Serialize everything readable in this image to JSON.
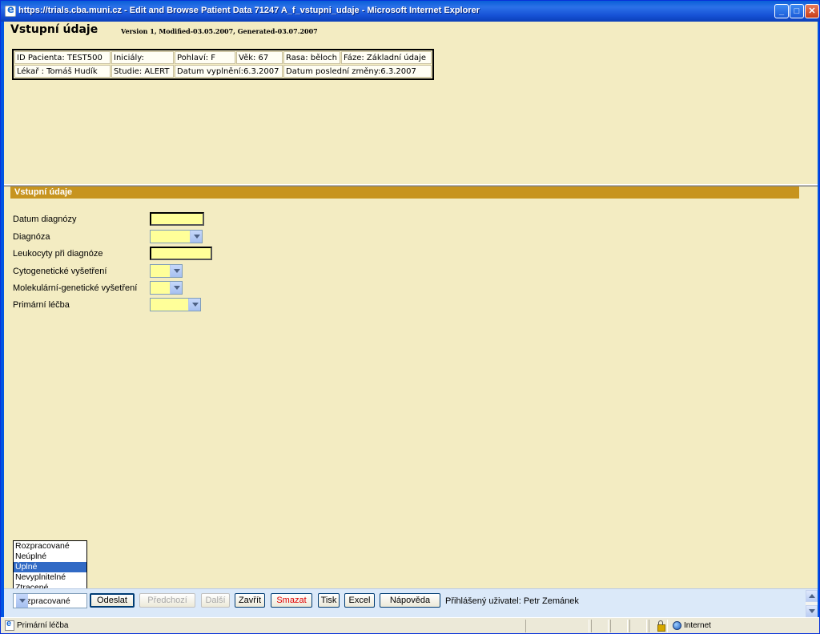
{
  "window": {
    "title": "https://trials.cba.muni.cz - Edit and Browse Patient Data 71247 A_f_vstupni_udaje - Microsoft Internet Explorer",
    "minimize": "_",
    "maximize": "□",
    "close": "✕"
  },
  "header": {
    "title": "Vstupní údaje",
    "version": "Version 1, Modified-03.05.2007, Generated-03.07.2007"
  },
  "patient": {
    "row1": [
      "ID Pacienta: TEST500",
      "Iniciály:",
      "Pohlaví: F",
      "Věk: 67",
      "Rasa: běloch",
      "Fáze: Základní údaje"
    ],
    "row2": [
      "Lékař : Tomáš Hudík",
      "Studie: ALERT",
      "Datum vyplnění:6.3.2007",
      "Datum poslední změny:6.3.2007"
    ]
  },
  "section": {
    "title": "Vstupní údaje"
  },
  "form": {
    "fields": [
      {
        "label": "Datum diagnózy",
        "type": "text",
        "value": ""
      },
      {
        "label": "Diagnóza",
        "type": "select",
        "value": ""
      },
      {
        "label": "Leukocyty při diagnóze",
        "type": "text",
        "value": ""
      },
      {
        "label": "Cytogenetické vyšetření",
        "type": "select",
        "value": ""
      },
      {
        "label": "Molekulární-genetické vyšetření",
        "type": "select",
        "value": ""
      },
      {
        "label": "Primární léčba",
        "type": "select",
        "value": ""
      }
    ]
  },
  "status_dropdown": {
    "options": [
      "Rozpracované",
      "Neúplné",
      "Úplné",
      "Nevyplnitelné",
      "Ztracené"
    ],
    "highlighted_index": 2,
    "selected": "Rozpracované"
  },
  "toolbar": {
    "send": "Odeslat",
    "previous": "Předchozí",
    "next": "Další",
    "close": "Zavřít",
    "delete": "Smazat",
    "print": "Tisk",
    "excel": "Excel",
    "help": "Nápověda",
    "logged_user": "Přihlášený uživatel: Petr Zemánek"
  },
  "statusbar": {
    "text": "Primární léčba",
    "zone": "Internet"
  }
}
